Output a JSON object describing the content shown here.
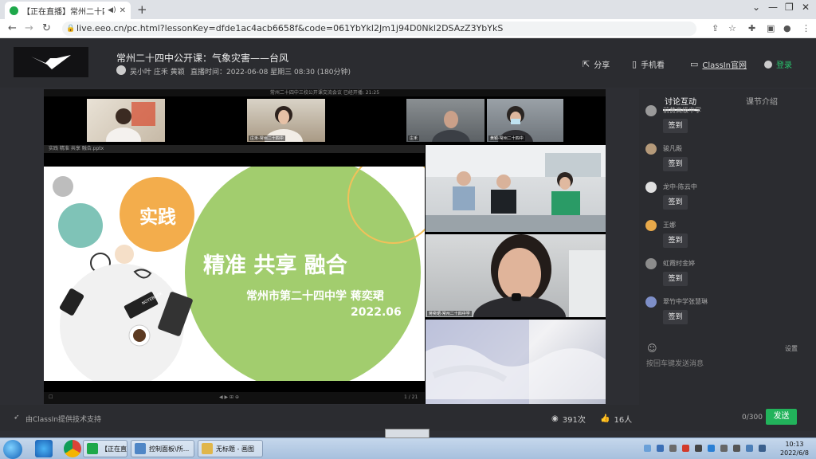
{
  "browser": {
    "tab_title": "【正在直播】常州二十四中公",
    "url": "live.eeo.cn/pc.html?lessonKey=dfde1ac4acb6658f&code=061YbYkl2Jm1j94D0Nkl2DSAzZ3YbYkS"
  },
  "header": {
    "lesson_title": "常州二十四中公开课：气象灾害——台风",
    "teachers": "吴小叶 庄禾 黄颖",
    "live_time": "直播时间：2022-06-08 星期三 08:30 (180分钟)",
    "share": "分享",
    "mobile": "手机看",
    "classin": "ClassIn官网",
    "login": "登录"
  },
  "conference": {
    "titlebar": "常州二十四中三校公开课交流会议  已经开播: 21:25",
    "ppt_bar": "实践 精准 共享 融合.pptx",
    "ppt_page": "1 / 21",
    "tiles": [
      {
        "name": ""
      },
      {
        "name": "庄禾-常州二十四中"
      },
      {
        "name": "庄禾"
      },
      {
        "name": "黄颖-常州二十四中"
      },
      {
        "name": "蒋奕珺-常州二十四中学"
      }
    ]
  },
  "slide": {
    "badge": "实践",
    "headline": "精准 共享 融合",
    "school": "常州市第二十四中学 蒋奕珺",
    "date": "2022.06",
    "notebook_text": "NOTEBOOK"
  },
  "chat": {
    "tab_discussion": "讨论互动",
    "tab_intro": "课节介绍",
    "messages": [
      {
        "name": "前黄高级中学",
        "button": "签到",
        "color": "#9a9a9a"
      },
      {
        "name": "骏凡殿",
        "button": "签到",
        "color": "#b59a7a"
      },
      {
        "name": "龙中-陈云中",
        "button": "签到",
        "color": "#e0e0e0"
      },
      {
        "name": "王娜",
        "button": "签到",
        "color": "#e8a94a"
      },
      {
        "name": "虹霞时金婷",
        "button": "签到",
        "color": "#8c8c8c"
      },
      {
        "name": "翠竹中学张慧琳",
        "button": "签到",
        "color": "#7e8fc8"
      }
    ],
    "settings": "设置",
    "placeholder": "按回车键发送消息",
    "counter": "0/300",
    "send": "发送"
  },
  "footer": {
    "support": "由ClassIn提供技术支持",
    "views": "391次",
    "likes": "16人"
  },
  "taskbar": {
    "tasks": [
      "【正在直播】...",
      "控制面板\\所...",
      "无标题 - 画图"
    ],
    "time": "10:13",
    "date": "2022/6/8"
  }
}
